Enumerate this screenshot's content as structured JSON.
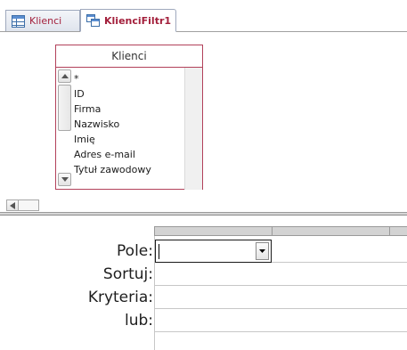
{
  "tabs": [
    {
      "label": "Klienci",
      "icon": "table-icon",
      "active": false
    },
    {
      "label": "KlienciFiltr1",
      "icon": "query-icon",
      "active": true
    }
  ],
  "table_box": {
    "title": "Klienci",
    "fields": [
      {
        "label": "*",
        "primary_key": false
      },
      {
        "label": "ID",
        "primary_key": true
      },
      {
        "label": "Firma",
        "primary_key": false
      },
      {
        "label": "Nazwisko",
        "primary_key": false
      },
      {
        "label": "Imię",
        "primary_key": false
      },
      {
        "label": "Adres e-mail",
        "primary_key": false
      },
      {
        "label": "Tytuł zawodowy",
        "primary_key": false
      }
    ]
  },
  "grid": {
    "row_labels": {
      "field": "Pole:",
      "sort": "Sortuj:",
      "criteria": "Kryteria:",
      "or": "lub:"
    },
    "field_value": ""
  },
  "colors": {
    "tab_text": "#a3203c",
    "table_border": "#b2415a"
  }
}
